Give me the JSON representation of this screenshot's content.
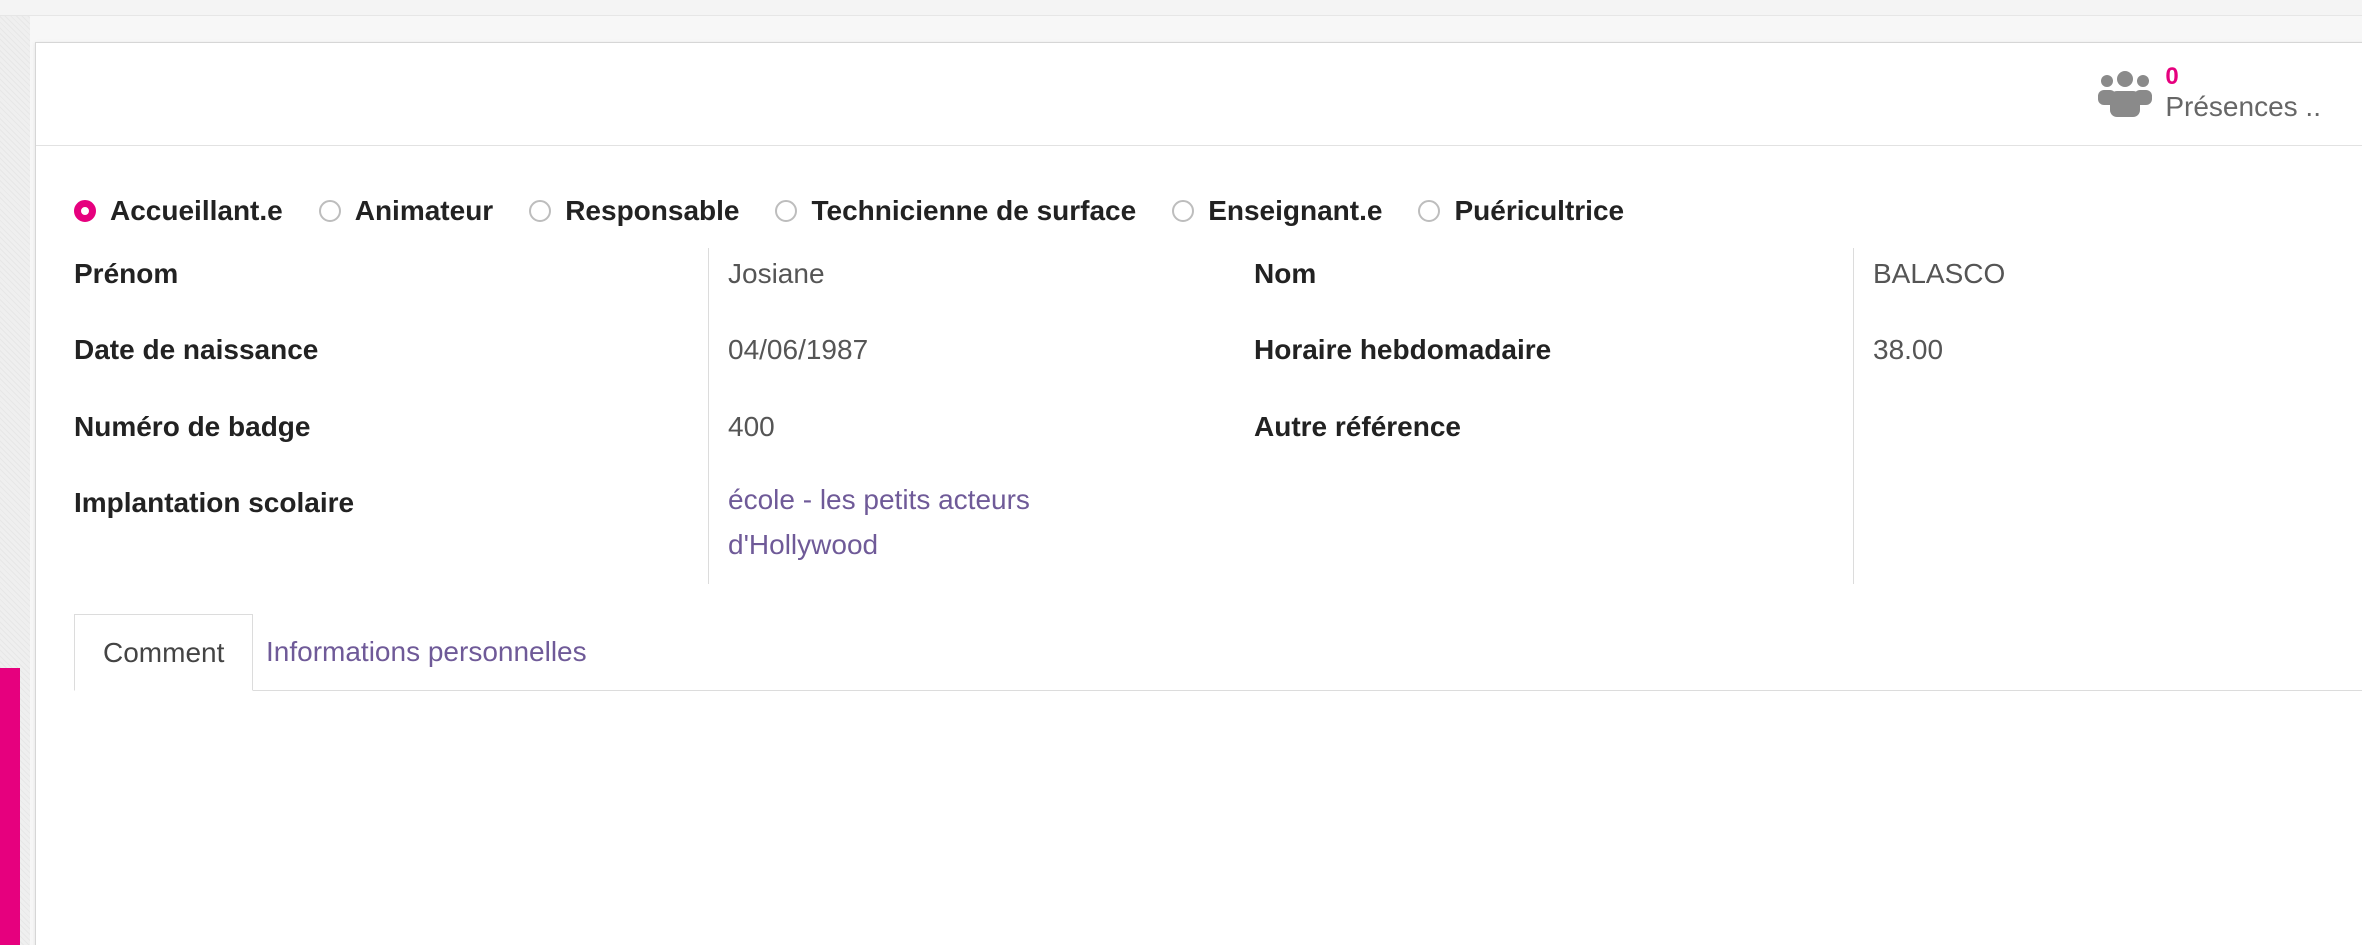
{
  "stat_button": {
    "icon": "users-icon",
    "value": "0",
    "label": "Présences ..",
    "accent_color": "#e6007e"
  },
  "roles": [
    {
      "label": "Accueillant.e",
      "checked": true
    },
    {
      "label": "Animateur",
      "checked": false
    },
    {
      "label": "Responsable",
      "checked": false
    },
    {
      "label": "Technicienne de surface",
      "checked": false
    },
    {
      "label": "Enseignant.e",
      "checked": false
    },
    {
      "label": "Puéricultrice",
      "checked": false
    }
  ],
  "fields": {
    "prenom_label": "Prénom",
    "prenom_value": "Josiane",
    "birth_label": "Date de naissance",
    "birth_value": "04/06/1987",
    "badge_label": "Numéro de badge",
    "badge_value": "400",
    "school_label": "Implantation scolaire",
    "school_value_line1": "école - les petits acteurs",
    "school_value_line2": "d'Hollywood",
    "nom_label": "Nom",
    "nom_value": "BALASCO",
    "hours_label": "Horaire hebdomadaire",
    "hours_value": "38.00",
    "ref_label": "Autre référence",
    "ref_value": ""
  },
  "tabs": [
    {
      "label": "Comment",
      "active": true
    },
    {
      "label": "Informations personnelles",
      "active": false
    }
  ],
  "colors": {
    "accent": "#e6007e",
    "link": "#6f5a98"
  }
}
